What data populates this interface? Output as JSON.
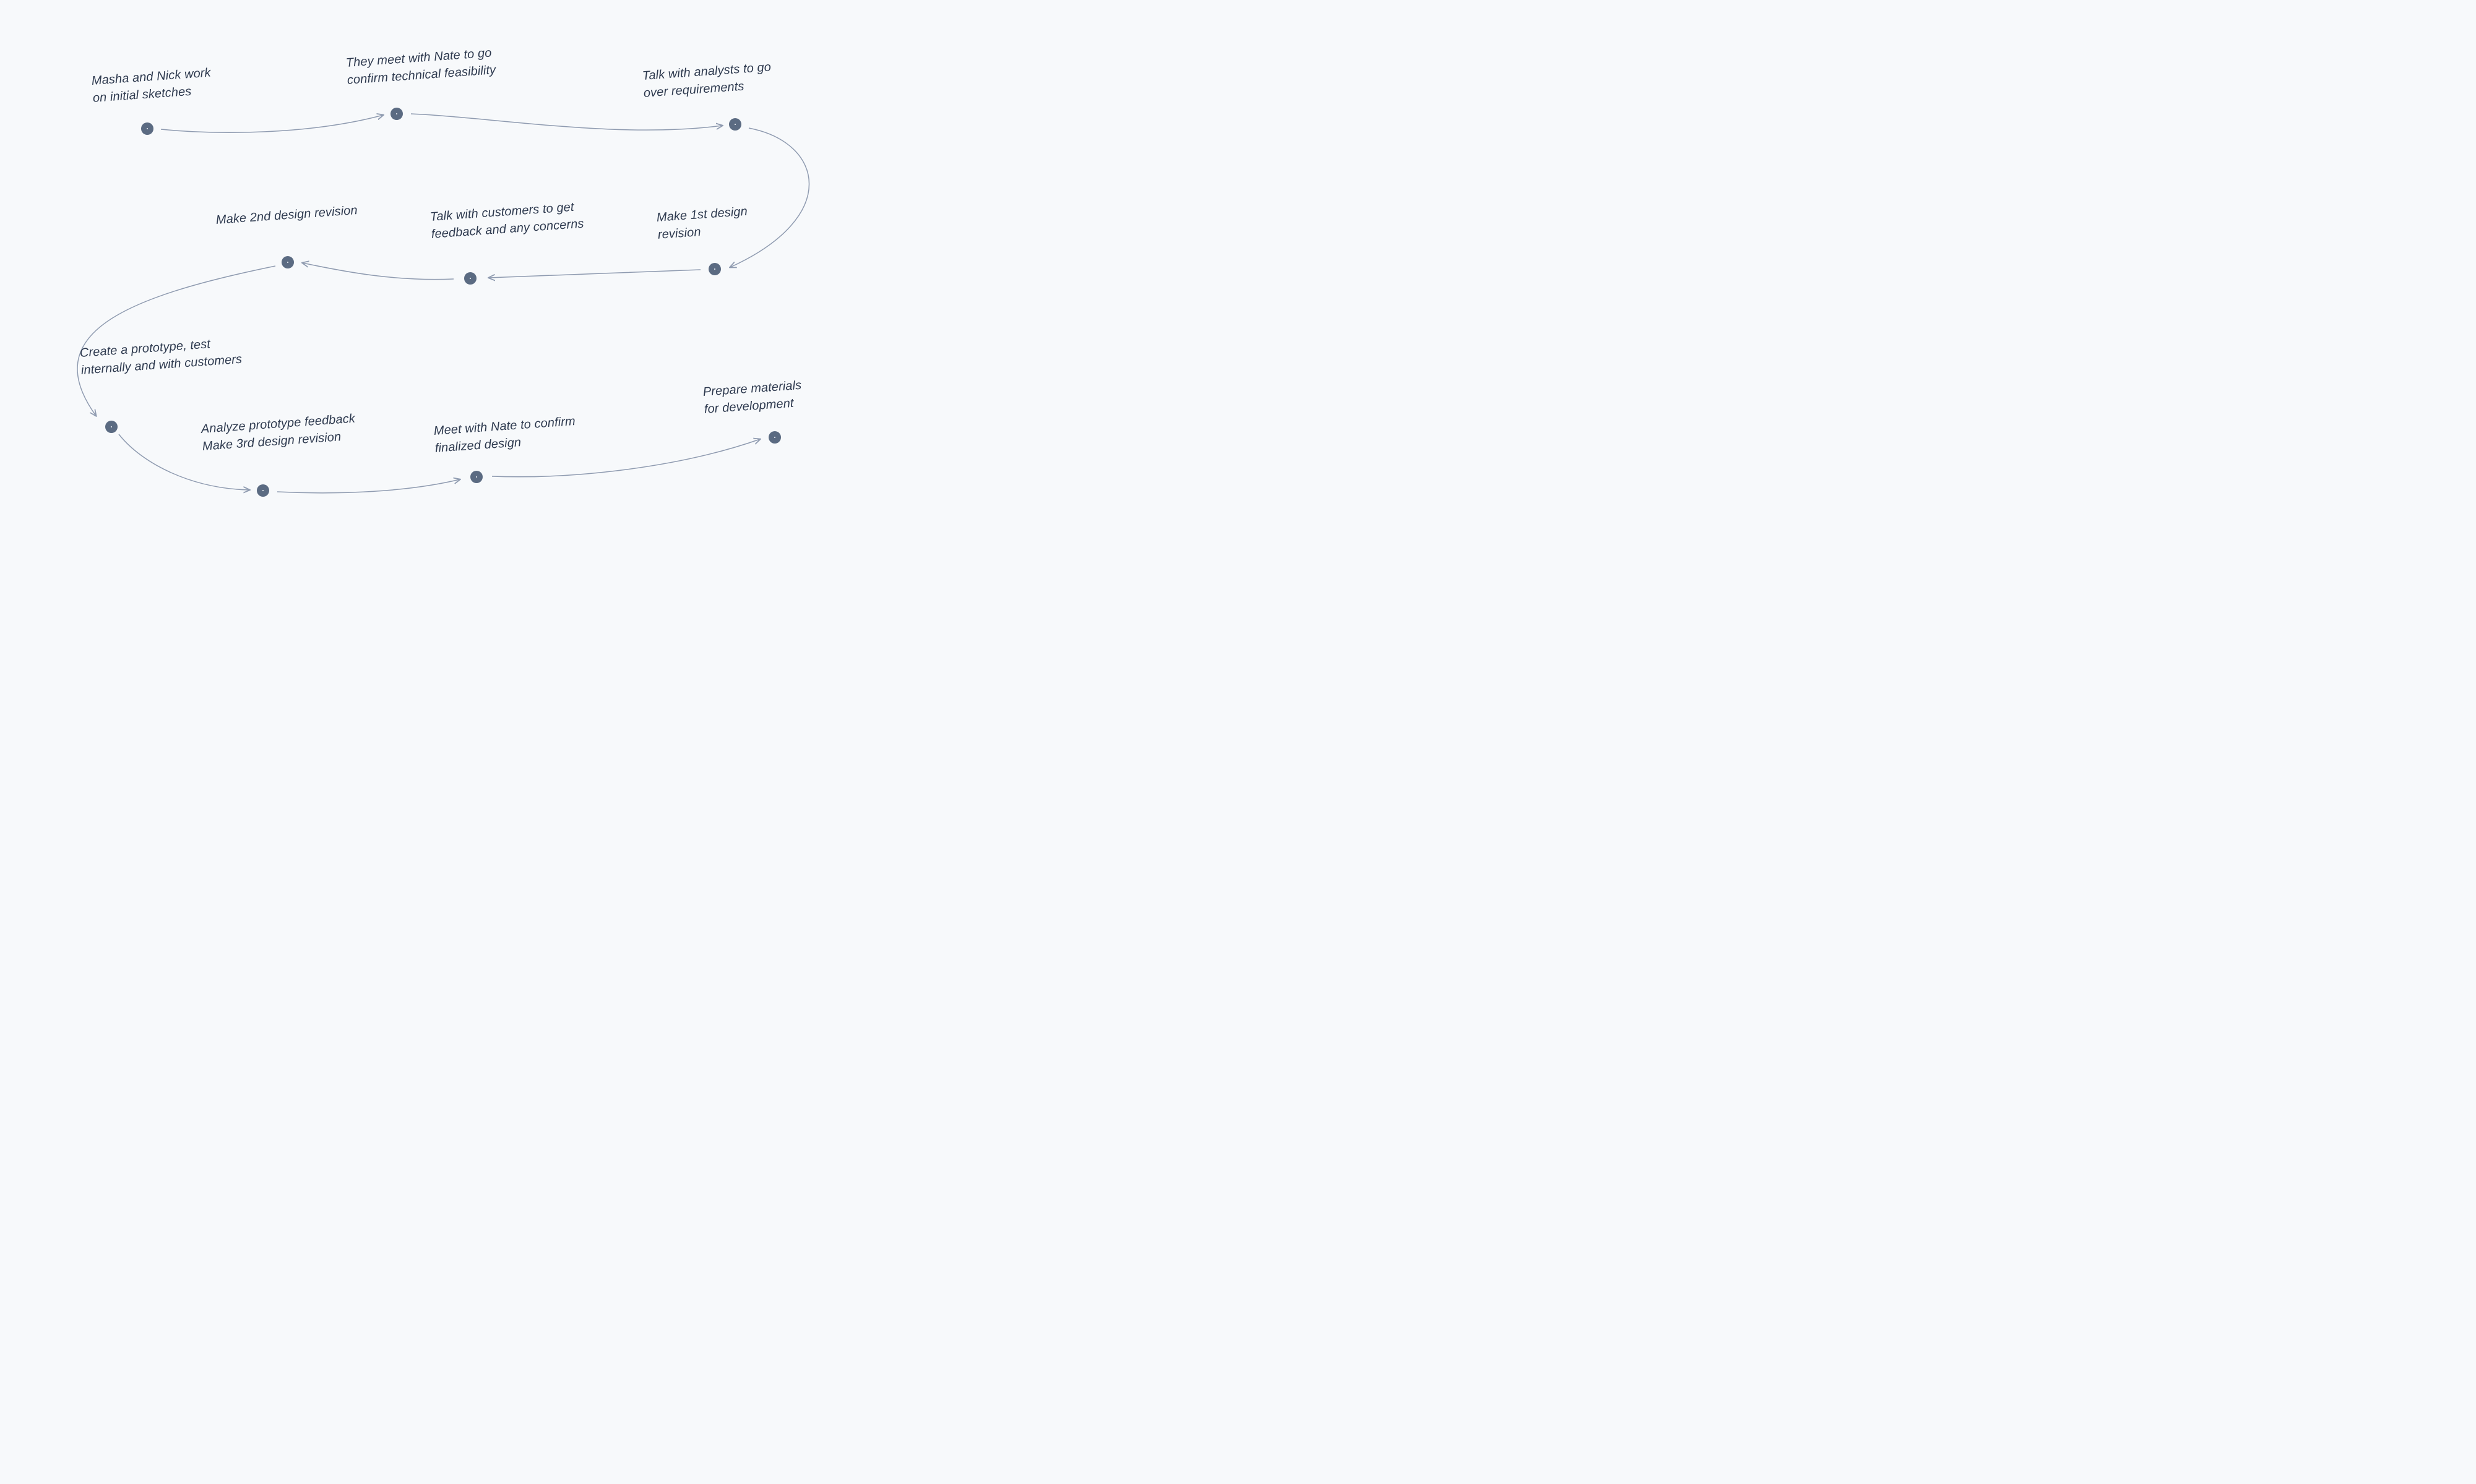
{
  "colors": {
    "background": "#f7f9fb",
    "node": "#5b6b82",
    "text": "#2e3a4f",
    "arrow": "#8f9bb0"
  },
  "steps": [
    {
      "id": 1,
      "label": "Masha and Nick work\non initial sketches"
    },
    {
      "id": 2,
      "label": "They meet with Nate to go\nconfirm technical feasibility"
    },
    {
      "id": 3,
      "label": "Talk with analysts to go\nover requirements"
    },
    {
      "id": 4,
      "label": "Make 1st design\nrevision"
    },
    {
      "id": 5,
      "label": "Talk with customers to get\nfeedback and  any concerns"
    },
    {
      "id": 6,
      "label": "Make 2nd design revision"
    },
    {
      "id": 7,
      "label": "Create a prototype, test\ninternally and with customers"
    },
    {
      "id": 8,
      "label": "Analyze prototype feedback\nMake 3rd design revision"
    },
    {
      "id": 9,
      "label": "Meet with Nate to confirm\nfinalized design"
    },
    {
      "id": 10,
      "label": "Prepare materials\nfor development"
    }
  ]
}
